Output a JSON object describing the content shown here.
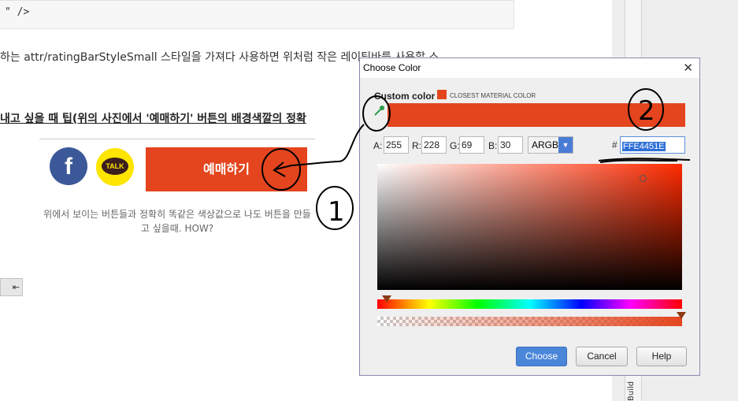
{
  "page": {
    "code_snippet": "\" />",
    "paragraph": "하는 attr/ratingBarStyleSmall 스타일을 가져다 사용하면 위처럼 작은 레이팅바를 사용할 스",
    "heading": "내고 싶을 때 팁(위의 사진에서 '예매하기' 버튼의 배경색깔의 정확",
    "facebook_label": "f",
    "kakao_label": "TALK",
    "reserve_button": "예매하기",
    "caption": "위에서 보이는 버튼들과 정확히 똑같은 색상값으로 나도 버튼을 만들고 싶을때. HOW?",
    "mini_toolbar": "⇤",
    "side_tab": "Build"
  },
  "dialog": {
    "title": "Choose Color",
    "close": "✕",
    "custom_color_label": "Custom color",
    "closest_material_label": "CLOSEST MATERIAL COLOR",
    "selected_color": "#e4451e",
    "channels": [
      {
        "label": "A:",
        "value": "255"
      },
      {
        "label": "R:",
        "value": "228"
      },
      {
        "label": "G:",
        "value": "69"
      },
      {
        "label": "B:",
        "value": "30"
      }
    ],
    "mode": "ARGB",
    "hash": "#",
    "hex_value": "FFE4451E",
    "buttons": {
      "choose": "Choose",
      "cancel": "Cancel",
      "help": "Help"
    }
  },
  "annotations": {
    "circle_1": "1",
    "circle_2": "2"
  }
}
